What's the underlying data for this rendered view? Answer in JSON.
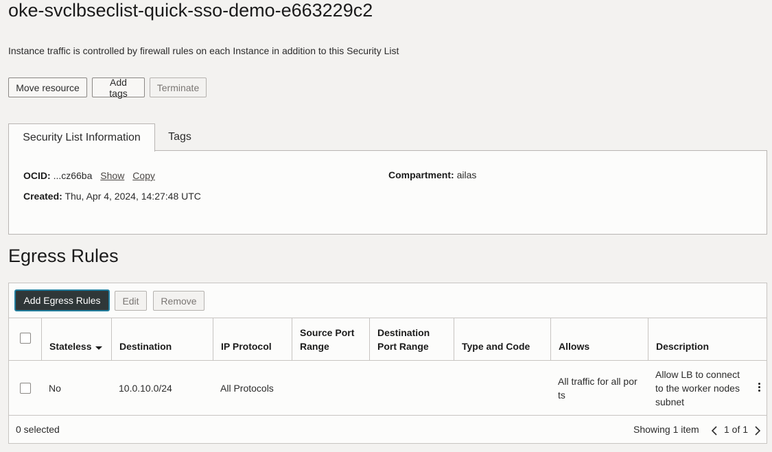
{
  "header": {
    "title": "oke-svclbseclist-quick-sso-demo-e663229c2",
    "subtitle": "Instance traffic is controlled by firewall rules on each Instance in addition to this Security List"
  },
  "actions": {
    "move_resource": "Move resource",
    "add_tags": "Add tags",
    "terminate": "Terminate"
  },
  "tabs": [
    {
      "label": "Security List Information",
      "active": true
    },
    {
      "label": "Tags",
      "active": false
    }
  ],
  "info": {
    "ocid_label": "OCID:",
    "ocid_value": "...cz66ba",
    "show_link": "Show",
    "copy_link": "Copy",
    "created_label": "Created:",
    "created_value": "Thu, Apr 4, 2024, 14:27:48 UTC",
    "compartment_label": "Compartment:",
    "compartment_value": "ailas"
  },
  "egress": {
    "section_title": "Egress Rules",
    "add_button": "Add Egress Rules",
    "edit_button": "Edit",
    "remove_button": "Remove",
    "columns": {
      "stateless": "Stateless",
      "destination": "Destination",
      "ip_protocol": "IP Protocol",
      "source_port_range": "Source Port Range",
      "destination_port_range": "Destination Port Range",
      "type_and_code": "Type and Code",
      "allows": "Allows",
      "description": "Description"
    },
    "rows": [
      {
        "stateless": "No",
        "destination": "10.0.10.0/24",
        "ip_protocol": "All Protocols",
        "source_port_range": "",
        "destination_port_range": "",
        "type_and_code": "",
        "allows": "All traffic for all ports",
        "description": "Allow LB to connect to the worker nodes subnet"
      }
    ],
    "selected_count": "0 selected",
    "showing": "Showing 1 item",
    "pagination": "1 of 1"
  },
  "colors": {
    "background": "#f3f2f0",
    "panel": "#fcfcfb",
    "primary_button": "#2f3738",
    "primary_focus_ring": "#227e9e",
    "border": "#c7c4c1"
  }
}
